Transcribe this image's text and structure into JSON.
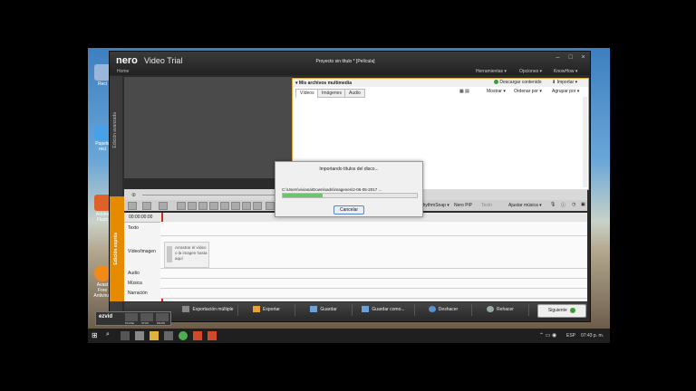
{
  "desktop": {
    "icons": [
      {
        "label": "Reci",
        "name": "recycle-bin-icon",
        "color": "#9ab6d8"
      },
      {
        "label": "Papele reci",
        "name": "recycle-bin-icon-2",
        "color": "#4aa0e6"
      },
      {
        "label": "Adobe Flash",
        "name": "flash-icon",
        "color": "#e0602a"
      },
      {
        "label": "Avast Free Antivirus",
        "name": "avast-icon",
        "color": "#f28a1a"
      }
    ]
  },
  "window": {
    "logo": "nero",
    "product": "Video Trial",
    "home": "Home",
    "title": "Proyecto sin título * [Película]",
    "menu": {
      "tools": "Herramientas ▾",
      "options": "Opciones ▾",
      "knowhow": "KnowHow ▾"
    },
    "side_label": "Edición avanzada",
    "express_label": "Edición exprés"
  },
  "media": {
    "header": "▾ Mis archivos multimedia",
    "download": "Descargar contenido",
    "import": "Importar ▾",
    "tabs": [
      "Vídeos",
      "Imágenes",
      "Audio"
    ],
    "show": "Mostrar ▾",
    "sort": "Ordenar por ▾",
    "group": "Agrupar por ▾"
  },
  "toolbar": {
    "rhythm": "RhythmSnap ▾",
    "pip": "Nero PiP",
    "texto": "Texto",
    "adjust_music": "Ajustar música ▾"
  },
  "timeline": {
    "time": "00:00:00:00",
    "tracks": [
      "Texto",
      "Vídeo/imagen",
      "Audio",
      "Música",
      "Narración"
    ],
    "drop_hint": "Arrastrar el vídeo o la imagen hasta aquí"
  },
  "dialog": {
    "title": "Importando títulos del disco...",
    "path": "C:\\Users\\viviana\\Downloads\\imagenes\\2-06-05-2017 ...",
    "cancel": "Cancelar"
  },
  "bottom": {
    "export_multiple": "Exportación múltiple",
    "export": "Exportar",
    "save": "Guardar",
    "save_as": "Guardar como...",
    "undo": "Deshacer",
    "redo": "Rehacer",
    "next": "Siguiente"
  },
  "ezvid": {
    "logo": "ezvid",
    "pause": "PAUSE",
    "stop": "STOP",
    "draw": "DRAW"
  },
  "taskbar": {
    "lang": "ESP",
    "clock": "07:43 p. m."
  },
  "colors": {
    "accent": "#e68a00",
    "next_green": "#3a9d3a",
    "playhead": "#d0261b"
  }
}
